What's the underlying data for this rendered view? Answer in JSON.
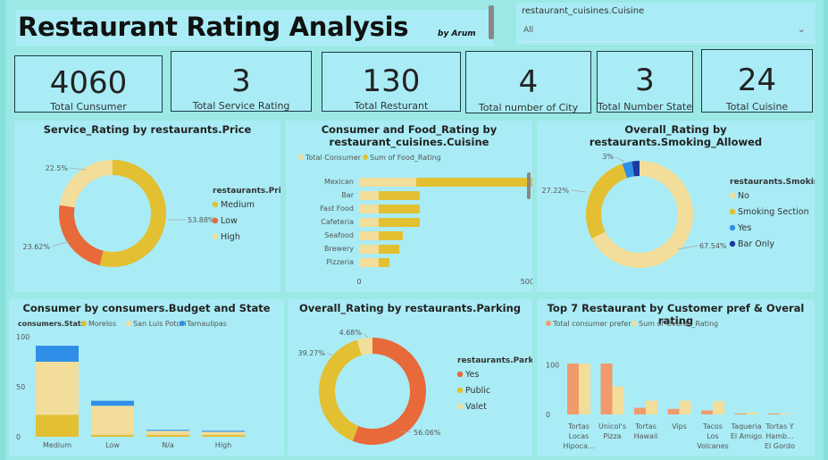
{
  "header": {
    "title": "Restaurant Rating Analysis",
    "subtitle": "by Arum"
  },
  "filter": {
    "label": "restaurant_cuisines.Cuisine",
    "value": "All"
  },
  "kpis": [
    {
      "value": "4060",
      "label": "Total Cunsumer"
    },
    {
      "value": "3",
      "label": "Total Service Rating"
    },
    {
      "value": "130",
      "label": "Total Resturant"
    },
    {
      "value": "4",
      "label": "Total number of City"
    },
    {
      "value": "3",
      "label": "Total Number State"
    },
    {
      "value": "24",
      "label": "Total Cuisine"
    }
  ],
  "colors": {
    "medium": "#e3bf32",
    "low": "#e8693a",
    "high": "#f3dd9a",
    "blue": "#2f8fe8",
    "navy": "#1a3a9c",
    "salmon": "#f19a6c"
  },
  "chart_data": [
    {
      "type": "pie",
      "title": "Service_Rating by restaurants.Price",
      "legend_title": "restaurants.Price",
      "labels": [
        "Medium",
        "Low",
        "High"
      ],
      "values": [
        53.88,
        23.62,
        22.5
      ],
      "value_labels": [
        "53.88%",
        "23.62%",
        "22.5%"
      ]
    },
    {
      "type": "bar",
      "title": "Consumer and Food_Rating by restaurant_cuisines.Cuisine",
      "categories": [
        "Mexican",
        "Bar",
        "Fast Food",
        "Cafeteria",
        "Seafood",
        "Brewery",
        "Pizzeria"
      ],
      "series": [
        {
          "name": "Total Consumer",
          "values": [
            170,
            0,
            0,
            0,
            0,
            0,
            0
          ]
        },
        {
          "name": "Sum of Food_Rating",
          "values": [
            548,
            180,
            180,
            180,
            130,
            120,
            90
          ]
        }
      ],
      "xticks": [
        "0",
        "500"
      ],
      "xlim": [
        0,
        600
      ]
    },
    {
      "type": "pie",
      "title": "Overall_Rating by restaurants.Smoking_Allowed",
      "legend_title": "restaurants.Smokin...",
      "labels": [
        "No",
        "Smoking Section",
        "Yes",
        "Bar Only"
      ],
      "values": [
        67.54,
        27.22,
        3,
        2.24
      ],
      "value_labels": [
        "67.54%",
        "27.22%",
        "3%"
      ]
    },
    {
      "type": "bar",
      "title": "Consumer by consumers.Budget and State",
      "legend_title": "consumers.State",
      "categories": [
        "Medium",
        "Low",
        "N/a",
        "High"
      ],
      "series": [
        {
          "name": "Morelos",
          "values": [
            22,
            2,
            2,
            2
          ]
        },
        {
          "name": "San Luis Potosi",
          "values": [
            53,
            29,
            4,
            3
          ]
        },
        {
          "name": "Tamaulipas",
          "values": [
            16,
            5,
            1,
            1
          ]
        }
      ],
      "yticks": [
        "0",
        "50",
        "100"
      ],
      "ylim": [
        0,
        100
      ]
    },
    {
      "type": "pie",
      "title": "Overall_Rating by restaurants.Parking",
      "legend_title": "restaurants.Parki...",
      "labels": [
        "Yes",
        "Public",
        "Valet"
      ],
      "values": [
        56.06,
        39.27,
        4.68
      ],
      "value_labels": [
        "56.06%",
        "39.27%",
        "4.68%"
      ]
    },
    {
      "type": "bar",
      "title": "Top 7 Restaurant by Customer pref & Overal rating",
      "categories": [
        "Tortas Locas Hipoca...",
        "Unicol's Pizza",
        "Tortas Hawaii",
        "Vips",
        "Tacos Los Volcanes",
        "Taqueria El Amigo",
        "Tortas Y Hamb... El Gordo"
      ],
      "category_lines": [
        [
          "Tortas",
          "Locas",
          "Hipoca..."
        ],
        [
          "Unicol's",
          "Pizza"
        ],
        [
          "Tortas",
          "Hawaii"
        ],
        [
          "Vips"
        ],
        [
          "Tacos",
          "Los",
          "Volcanes"
        ],
        [
          "Taqueria",
          "El Amigo"
        ],
        [
          "Tortas Y",
          "Hamb...",
          "El Gordo"
        ]
      ],
      "series": [
        {
          "name": "Total consumer prefer",
          "values": [
            100,
            100,
            13,
            11,
            8,
            2,
            2
          ]
        },
        {
          "name": "Sum of Overall_Rating",
          "values": [
            100,
            55,
            27,
            27,
            26,
            4,
            2
          ]
        }
      ],
      "yticks": [
        "0",
        "100"
      ],
      "ylim": [
        0,
        180
      ]
    }
  ]
}
